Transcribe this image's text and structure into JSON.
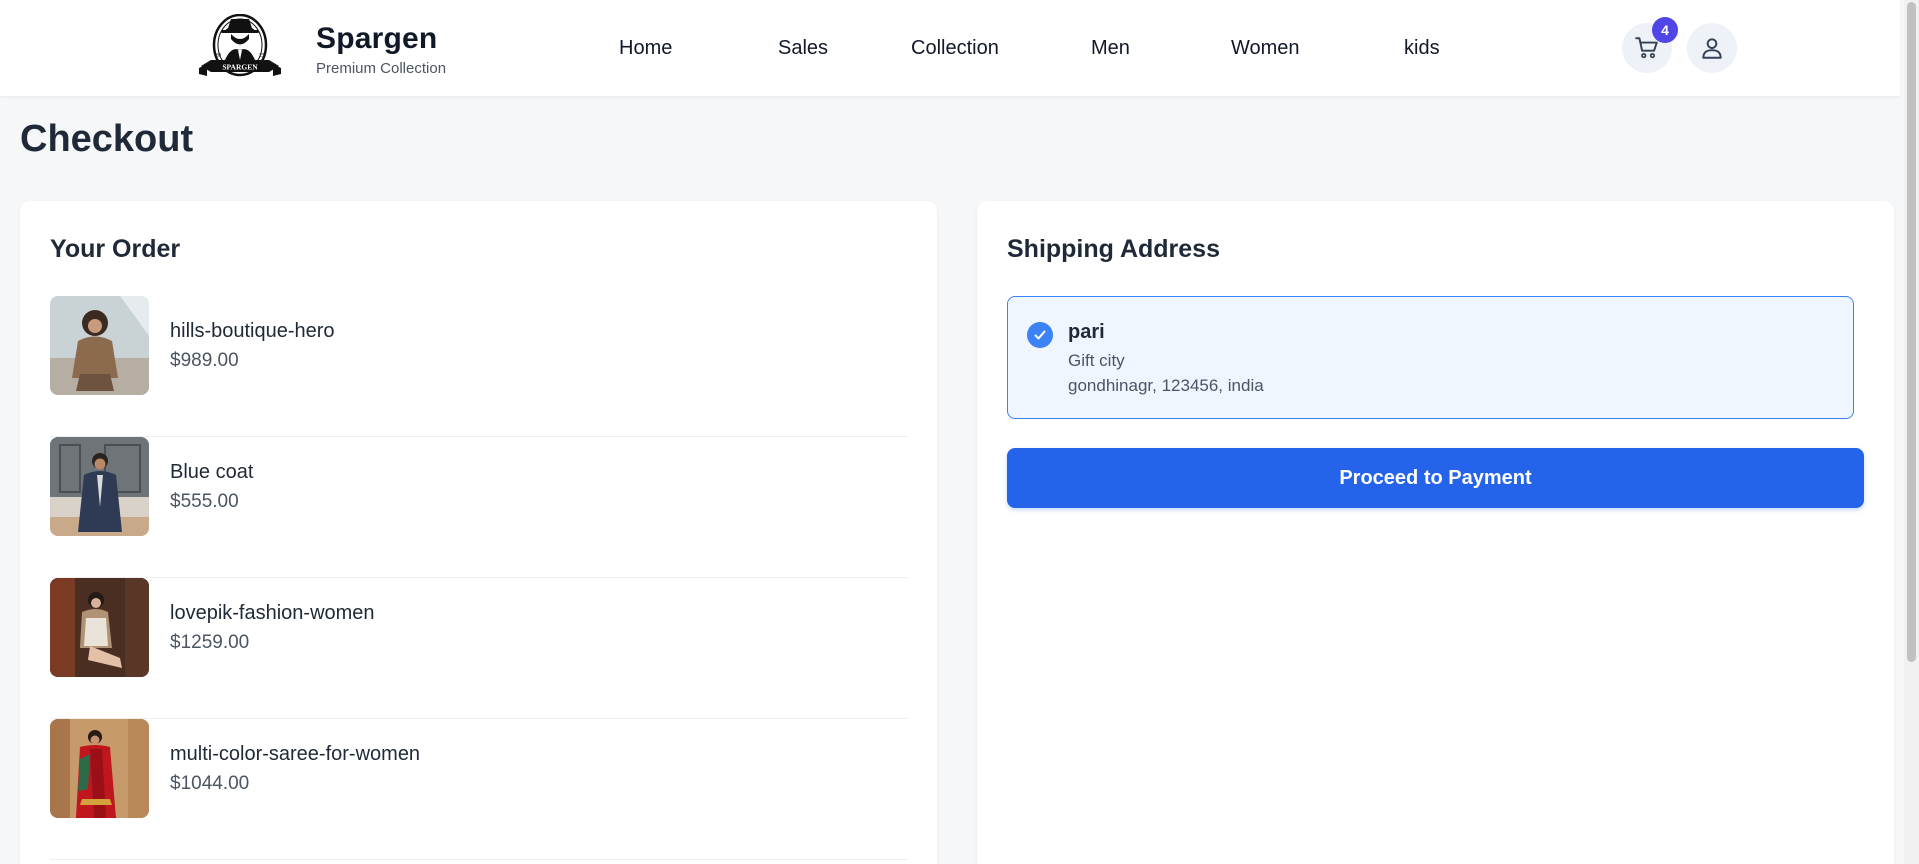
{
  "brand": {
    "name": "Spargen",
    "tagline": "Premium Collection",
    "logo_text": "SPARGEN",
    "logo_year_left": "20",
    "logo_year_right": "25"
  },
  "nav": {
    "items": [
      {
        "label": "Home"
      },
      {
        "label": "Sales"
      },
      {
        "label": "Collection"
      },
      {
        "label": "Men"
      },
      {
        "label": "Women"
      },
      {
        "label": "kids"
      }
    ]
  },
  "header_icons": {
    "cart_icon": "shopping-cart-icon",
    "cart_count": "4",
    "user_icon": "user-icon"
  },
  "page": {
    "title": "Checkout"
  },
  "order": {
    "heading": "Your Order",
    "items": [
      {
        "name": "hills-boutique-hero",
        "price": "$989.00"
      },
      {
        "name": "Blue coat",
        "price": "$555.00"
      },
      {
        "name": "lovepik-fashion-women",
        "price": "$1259.00"
      },
      {
        "name": "multi-color-saree-for-women",
        "price": "$1044.00"
      }
    ]
  },
  "shipping": {
    "heading": "Shipping Address",
    "address": {
      "name": "pari",
      "line1": "Gift city",
      "line2": "gondhinagr, 123456, india"
    },
    "button_label": "Proceed to Payment"
  },
  "colors": {
    "primary": "#2563eb",
    "selected_border": "#3b82f6",
    "badge": "#4f46e5"
  }
}
